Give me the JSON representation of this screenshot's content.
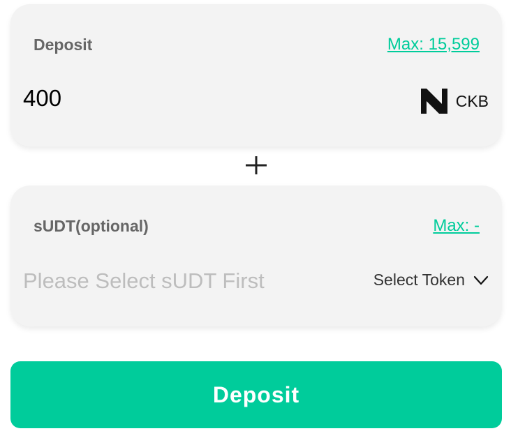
{
  "deposit_card": {
    "label": "Deposit",
    "max_text": "Max: 15,599",
    "amount_value": "400",
    "token_symbol": "CKB",
    "token_icon": "nervos-ckb-logo-icon"
  },
  "plus_icon": "plus-icon",
  "sudt_card": {
    "label": "sUDT(optional)",
    "max_text": "Max: -",
    "amount_placeholder": "Please Select sUDT First",
    "select_token_label": "Select Token",
    "select_icon": "chevron-down-icon"
  },
  "submit": {
    "label": "Deposit"
  },
  "colors": {
    "accent": "#00cc9b",
    "card_bg": "#f3f3f3",
    "label_text": "#666666",
    "placeholder_text": "#bdbdbd"
  }
}
